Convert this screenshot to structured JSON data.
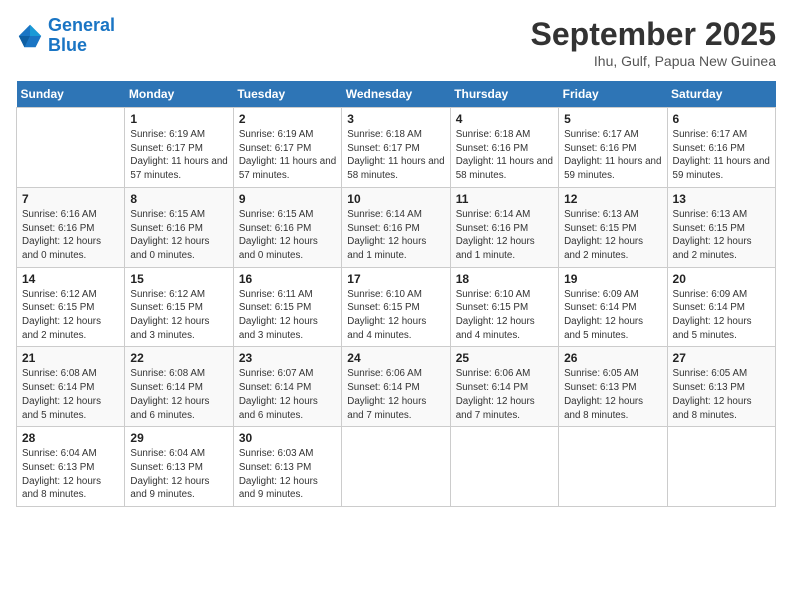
{
  "header": {
    "logo_line1": "General",
    "logo_line2": "Blue",
    "month": "September 2025",
    "location": "Ihu, Gulf, Papua New Guinea"
  },
  "weekdays": [
    "Sunday",
    "Monday",
    "Tuesday",
    "Wednesday",
    "Thursday",
    "Friday",
    "Saturday"
  ],
  "weeks": [
    [
      {
        "day": "",
        "sunrise": "",
        "sunset": "",
        "daylight": ""
      },
      {
        "day": "1",
        "sunrise": "Sunrise: 6:19 AM",
        "sunset": "Sunset: 6:17 PM",
        "daylight": "Daylight: 11 hours and 57 minutes."
      },
      {
        "day": "2",
        "sunrise": "Sunrise: 6:19 AM",
        "sunset": "Sunset: 6:17 PM",
        "daylight": "Daylight: 11 hours and 57 minutes."
      },
      {
        "day": "3",
        "sunrise": "Sunrise: 6:18 AM",
        "sunset": "Sunset: 6:17 PM",
        "daylight": "Daylight: 11 hours and 58 minutes."
      },
      {
        "day": "4",
        "sunrise": "Sunrise: 6:18 AM",
        "sunset": "Sunset: 6:16 PM",
        "daylight": "Daylight: 11 hours and 58 minutes."
      },
      {
        "day": "5",
        "sunrise": "Sunrise: 6:17 AM",
        "sunset": "Sunset: 6:16 PM",
        "daylight": "Daylight: 11 hours and 59 minutes."
      },
      {
        "day": "6",
        "sunrise": "Sunrise: 6:17 AM",
        "sunset": "Sunset: 6:16 PM",
        "daylight": "Daylight: 11 hours and 59 minutes."
      }
    ],
    [
      {
        "day": "7",
        "sunrise": "Sunrise: 6:16 AM",
        "sunset": "Sunset: 6:16 PM",
        "daylight": "Daylight: 12 hours and 0 minutes."
      },
      {
        "day": "8",
        "sunrise": "Sunrise: 6:15 AM",
        "sunset": "Sunset: 6:16 PM",
        "daylight": "Daylight: 12 hours and 0 minutes."
      },
      {
        "day": "9",
        "sunrise": "Sunrise: 6:15 AM",
        "sunset": "Sunset: 6:16 PM",
        "daylight": "Daylight: 12 hours and 0 minutes."
      },
      {
        "day": "10",
        "sunrise": "Sunrise: 6:14 AM",
        "sunset": "Sunset: 6:16 PM",
        "daylight": "Daylight: 12 hours and 1 minute."
      },
      {
        "day": "11",
        "sunrise": "Sunrise: 6:14 AM",
        "sunset": "Sunset: 6:16 PM",
        "daylight": "Daylight: 12 hours and 1 minute."
      },
      {
        "day": "12",
        "sunrise": "Sunrise: 6:13 AM",
        "sunset": "Sunset: 6:15 PM",
        "daylight": "Daylight: 12 hours and 2 minutes."
      },
      {
        "day": "13",
        "sunrise": "Sunrise: 6:13 AM",
        "sunset": "Sunset: 6:15 PM",
        "daylight": "Daylight: 12 hours and 2 minutes."
      }
    ],
    [
      {
        "day": "14",
        "sunrise": "Sunrise: 6:12 AM",
        "sunset": "Sunset: 6:15 PM",
        "daylight": "Daylight: 12 hours and 2 minutes."
      },
      {
        "day": "15",
        "sunrise": "Sunrise: 6:12 AM",
        "sunset": "Sunset: 6:15 PM",
        "daylight": "Daylight: 12 hours and 3 minutes."
      },
      {
        "day": "16",
        "sunrise": "Sunrise: 6:11 AM",
        "sunset": "Sunset: 6:15 PM",
        "daylight": "Daylight: 12 hours and 3 minutes."
      },
      {
        "day": "17",
        "sunrise": "Sunrise: 6:10 AM",
        "sunset": "Sunset: 6:15 PM",
        "daylight": "Daylight: 12 hours and 4 minutes."
      },
      {
        "day": "18",
        "sunrise": "Sunrise: 6:10 AM",
        "sunset": "Sunset: 6:15 PM",
        "daylight": "Daylight: 12 hours and 4 minutes."
      },
      {
        "day": "19",
        "sunrise": "Sunrise: 6:09 AM",
        "sunset": "Sunset: 6:14 PM",
        "daylight": "Daylight: 12 hours and 5 minutes."
      },
      {
        "day": "20",
        "sunrise": "Sunrise: 6:09 AM",
        "sunset": "Sunset: 6:14 PM",
        "daylight": "Daylight: 12 hours and 5 minutes."
      }
    ],
    [
      {
        "day": "21",
        "sunrise": "Sunrise: 6:08 AM",
        "sunset": "Sunset: 6:14 PM",
        "daylight": "Daylight: 12 hours and 5 minutes."
      },
      {
        "day": "22",
        "sunrise": "Sunrise: 6:08 AM",
        "sunset": "Sunset: 6:14 PM",
        "daylight": "Daylight: 12 hours and 6 minutes."
      },
      {
        "day": "23",
        "sunrise": "Sunrise: 6:07 AM",
        "sunset": "Sunset: 6:14 PM",
        "daylight": "Daylight: 12 hours and 6 minutes."
      },
      {
        "day": "24",
        "sunrise": "Sunrise: 6:06 AM",
        "sunset": "Sunset: 6:14 PM",
        "daylight": "Daylight: 12 hours and 7 minutes."
      },
      {
        "day": "25",
        "sunrise": "Sunrise: 6:06 AM",
        "sunset": "Sunset: 6:14 PM",
        "daylight": "Daylight: 12 hours and 7 minutes."
      },
      {
        "day": "26",
        "sunrise": "Sunrise: 6:05 AM",
        "sunset": "Sunset: 6:13 PM",
        "daylight": "Daylight: 12 hours and 8 minutes."
      },
      {
        "day": "27",
        "sunrise": "Sunrise: 6:05 AM",
        "sunset": "Sunset: 6:13 PM",
        "daylight": "Daylight: 12 hours and 8 minutes."
      }
    ],
    [
      {
        "day": "28",
        "sunrise": "Sunrise: 6:04 AM",
        "sunset": "Sunset: 6:13 PM",
        "daylight": "Daylight: 12 hours and 8 minutes."
      },
      {
        "day": "29",
        "sunrise": "Sunrise: 6:04 AM",
        "sunset": "Sunset: 6:13 PM",
        "daylight": "Daylight: 12 hours and 9 minutes."
      },
      {
        "day": "30",
        "sunrise": "Sunrise: 6:03 AM",
        "sunset": "Sunset: 6:13 PM",
        "daylight": "Daylight: 12 hours and 9 minutes."
      },
      {
        "day": "",
        "sunrise": "",
        "sunset": "",
        "daylight": ""
      },
      {
        "day": "",
        "sunrise": "",
        "sunset": "",
        "daylight": ""
      },
      {
        "day": "",
        "sunrise": "",
        "sunset": "",
        "daylight": ""
      },
      {
        "day": "",
        "sunrise": "",
        "sunset": "",
        "daylight": ""
      }
    ]
  ]
}
